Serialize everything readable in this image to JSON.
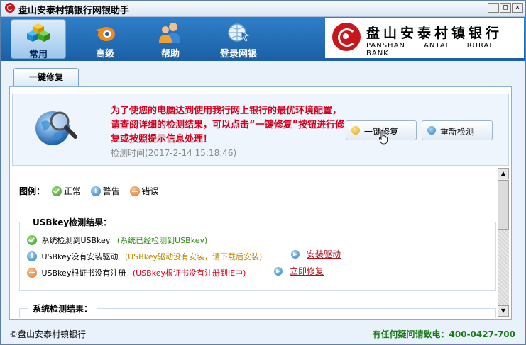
{
  "window": {
    "title": "盘山安泰村镇银行网银助手",
    "controls": {
      "minimize": "_",
      "maximize": "□",
      "close": "×"
    }
  },
  "toolbar": {
    "items": [
      {
        "label": "常用",
        "icon": "cubes-icon",
        "active": true
      },
      {
        "label": "高级",
        "icon": "blender-icon",
        "active": false
      },
      {
        "label": "帮助",
        "icon": "users-icon",
        "active": false
      },
      {
        "label": "登录网银",
        "icon": "globe-cursor-icon",
        "active": false
      }
    ]
  },
  "bank": {
    "name_cn": "盘山安泰村镇银行",
    "name_en": "PANSHAN ANTAI RURAL BANK"
  },
  "tab": {
    "label": "一键修复"
  },
  "info": {
    "message": "为了使您的电脑达到使用我行网上银行的最优环境配置，请查阅详细的检测结果，可以点击“一键修复”按钮进行修复或按照提示信息处理！",
    "time_label": "检测时间",
    "time_value": "(2017-2-14  15:18:46)",
    "repair_button": "一键修复",
    "recheck_button": "重新检测"
  },
  "legend": {
    "title": "图例：",
    "ok": "正常",
    "warn": "警告",
    "err": "错误"
  },
  "usbkey": {
    "title": "USBkey检测结果：",
    "rows": [
      {
        "status": "ok",
        "text": "系统检测到USBkey",
        "note": "(系统已经检测到USBkey)",
        "action": ""
      },
      {
        "status": "warn",
        "text": "USBkey没有安装驱动",
        "note": "(USBkey驱动没有安装，请下载后安装)",
        "action": "安装驱动"
      },
      {
        "status": "err",
        "text": "USBkey根证书没有注册",
        "note": "(USBkey根证书没有注册到IE中)",
        "action": "立即修复"
      }
    ]
  },
  "system": {
    "title": "系统检测结果："
  },
  "status": {
    "left": "©盘山安泰村镇银行",
    "right": "有任何疑问请致电：400-0427-700"
  },
  "colors": {
    "toolbar": "#1b5fa6",
    "accent_red": "#d6001c",
    "ok": "#2a8a13",
    "warn": "#b58900"
  }
}
